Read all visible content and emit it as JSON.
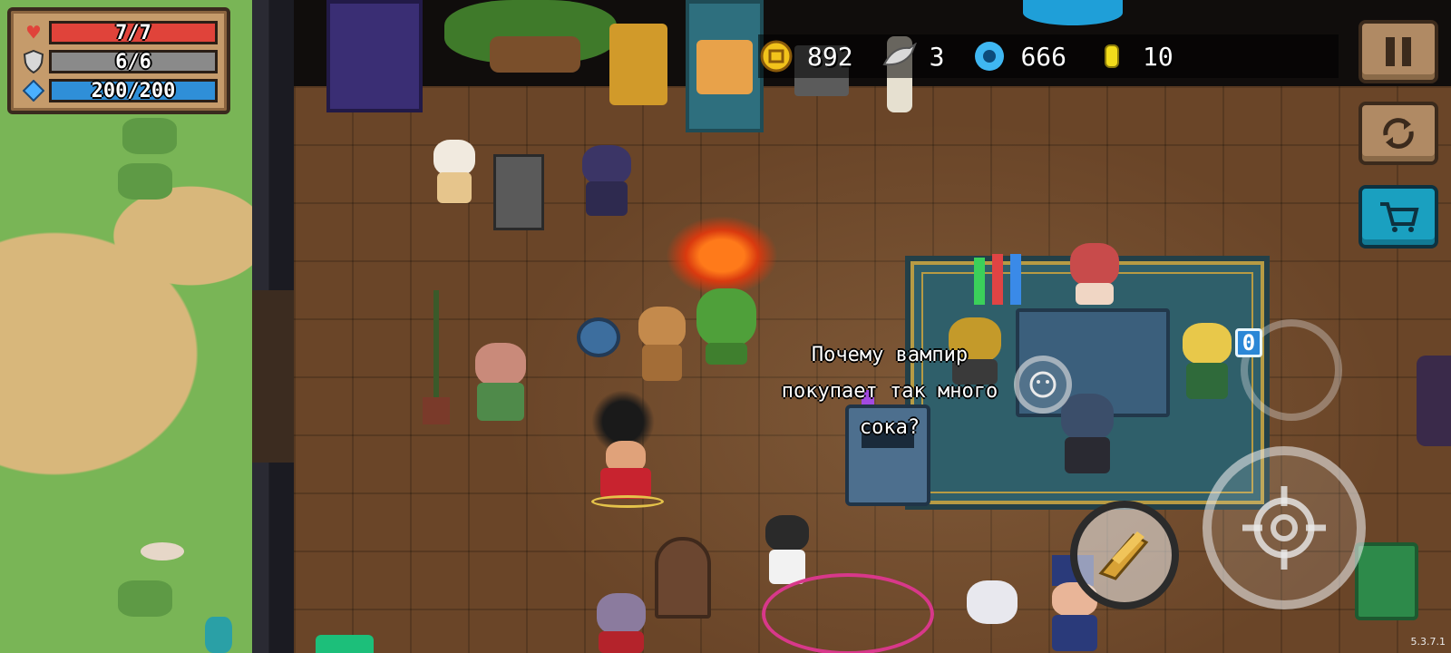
{
  "hud": {
    "hp": {
      "label": "7/7",
      "current": 7,
      "max": 7,
      "color": "#e0433a",
      "icon": "heart-icon"
    },
    "armor": {
      "label": "6/6",
      "current": 6,
      "max": 6,
      "color": "#8a8a8a",
      "icon": "shield-icon"
    },
    "energy": {
      "label": "200/200",
      "current": 200,
      "max": 200,
      "color": "#2f8fd8",
      "icon": "energy-gem-icon"
    }
  },
  "currencies": {
    "coins": {
      "value": "892",
      "icon": "gold-coin-icon",
      "color": "#f2c31b"
    },
    "fish": {
      "value": "3",
      "icon": "fish-icon",
      "color": "#d9d9d9"
    },
    "gems": {
      "value": "666",
      "icon": "blue-gem-icon",
      "color": "#3fb7f2"
    },
    "tokens": {
      "value": "10",
      "icon": "gold-token-icon",
      "color": "#f2dc1b"
    }
  },
  "side_buttons": {
    "pause": {
      "icon": "pause-icon"
    },
    "swap": {
      "icon": "swap-character-icon"
    },
    "shop": {
      "icon": "shopping-cart-icon"
    }
  },
  "dialogue": {
    "line1": "Почему вампир",
    "line2": "покупает так много",
    "line3": "сока?"
  },
  "controls": {
    "weapon_slot": {
      "icon": "golden-gun-icon"
    },
    "skill_counter": "0",
    "attack": {
      "icon": "crosshair-icon"
    }
  },
  "version": "5.3.7.1"
}
